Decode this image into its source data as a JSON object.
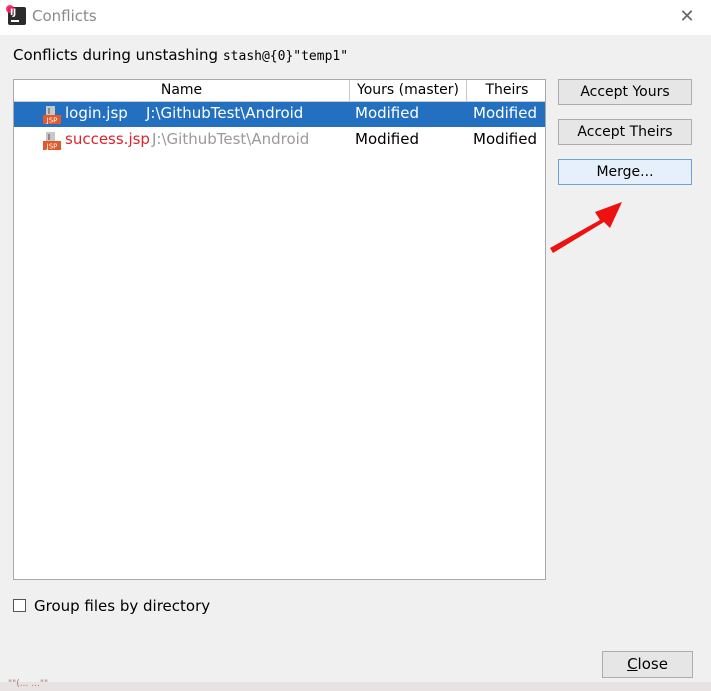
{
  "window": {
    "title": "Conflicts",
    "close_glyph": "✕"
  },
  "heading": {
    "text": "Conflicts during unstashing ",
    "stash": "stash@{0}\"temp1\""
  },
  "table": {
    "columns": [
      "Name",
      "Yours (master)",
      "Theirs"
    ],
    "rows": [
      {
        "name": "login.jsp",
        "path": "J:\\GithubTest\\Android",
        "yours": "Modified",
        "theirs": "Modified",
        "selected": true,
        "icon": "jsp-file-icon"
      },
      {
        "name": "success.jsp",
        "path": "J:\\GithubTest\\Android",
        "yours": "Modified",
        "theirs": "Modified",
        "selected": false,
        "icon": "jsp-file-icon"
      }
    ]
  },
  "buttons": {
    "accept_yours": "Accept Yours",
    "accept_theirs": "Accept Theirs",
    "merge": "Merge..."
  },
  "options": {
    "group_by_directory": "Group files by directory"
  },
  "footer": {
    "close_first": "C",
    "close_rest": "lose"
  },
  "bottom_edge": {
    "text": "\"\"(... ...\"\""
  },
  "colors": {
    "selection": "#2470c0",
    "conflict_red": "#e0232a",
    "arrow": "#ee1111"
  }
}
